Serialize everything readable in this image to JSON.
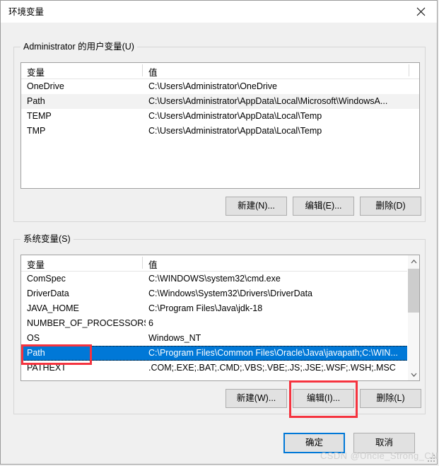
{
  "window": {
    "title": "环境变量",
    "close_label": "×"
  },
  "user_section": {
    "legend": "Administrator 的用户变量(U)",
    "columns": {
      "name": "变量",
      "value": "值"
    },
    "rows": [
      {
        "name": "OneDrive",
        "value": "C:\\Users\\Administrator\\OneDrive",
        "state": "normal"
      },
      {
        "name": "Path",
        "value": "C:\\Users\\Administrator\\AppData\\Local\\Microsoft\\WindowsA...",
        "state": "hover"
      },
      {
        "name": "TEMP",
        "value": "C:\\Users\\Administrator\\AppData\\Local\\Temp",
        "state": "normal"
      },
      {
        "name": "TMP",
        "value": "C:\\Users\\Administrator\\AppData\\Local\\Temp",
        "state": "normal"
      }
    ],
    "buttons": {
      "new": "新建(N)...",
      "edit": "编辑(E)...",
      "delete": "删除(D)"
    }
  },
  "system_section": {
    "legend": "系统变量(S)",
    "columns": {
      "name": "变量",
      "value": "值"
    },
    "rows": [
      {
        "name": "ComSpec",
        "value": "C:\\WINDOWS\\system32\\cmd.exe",
        "state": "normal"
      },
      {
        "name": "DriverData",
        "value": "C:\\Windows\\System32\\Drivers\\DriverData",
        "state": "normal"
      },
      {
        "name": "JAVA_HOME",
        "value": "C:\\Program Files\\Java\\jdk-18",
        "state": "normal"
      },
      {
        "name": "NUMBER_OF_PROCESSORS",
        "value": "6",
        "state": "normal"
      },
      {
        "name": "OS",
        "value": "Windows_NT",
        "state": "normal"
      },
      {
        "name": "Path",
        "value": "C:\\Program Files\\Common Files\\Oracle\\Java\\javapath;C:\\WIN...",
        "state": "selected"
      },
      {
        "name": "PATHEXT",
        "value": ".COM;.EXE;.BAT;.CMD;.VBS;.VBE;.JS;.JSE;.WSF;.WSH;.MSC",
        "state": "normal"
      }
    ],
    "buttons": {
      "new": "新建(W)...",
      "edit": "编辑(I)...",
      "delete": "删除(L)"
    }
  },
  "footer": {
    "ok": "确定",
    "cancel": "取消"
  },
  "watermark": "CSDN @Uncle_Strong_CN",
  "colors": {
    "selection": "#0078d7",
    "annotation": "#f5333f",
    "dialog_bg": "#f0f0f0",
    "list_bg": "#ffffff",
    "button_bg": "#e1e1e1",
    "watermark": "#cfcfcf"
  }
}
